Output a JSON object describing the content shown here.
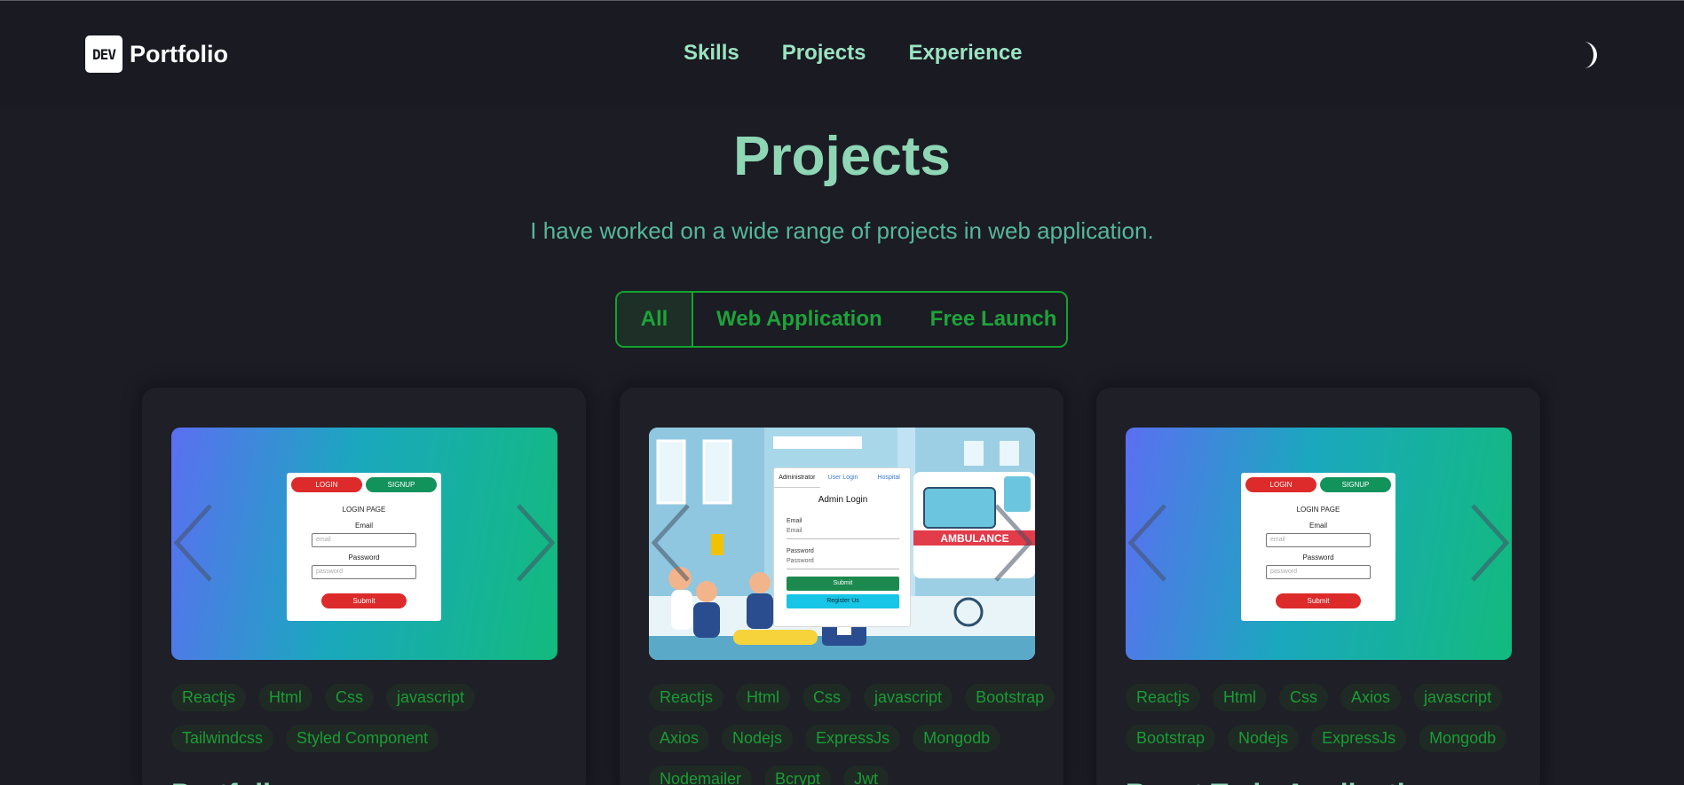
{
  "header": {
    "logo_badge": "DEV",
    "logo_text": "Portfolio",
    "nav": [
      "Skills",
      "Projects",
      "Experience"
    ],
    "theme_icon": "moon-icon"
  },
  "hero": {
    "title": "Projects",
    "subtitle": "I have worked on a wide range of projects in web application."
  },
  "filters": {
    "items": [
      "All",
      "Web Application",
      "Free Launch"
    ],
    "active": "All"
  },
  "projects": [
    {
      "title": "Portfolio",
      "tags": [
        "Reactjs",
        "Html",
        "Css",
        "javascript",
        "Tailwindcss",
        "Styled Component"
      ],
      "preview": {
        "login_tab": "LOGIN",
        "signup_tab": "SIGNUP",
        "heading": "LOGIN PAGE",
        "email_label": "Email",
        "email_placeholder": "email",
        "password_label": "Password",
        "password_placeholder": "password",
        "submit": "Submit"
      }
    },
    {
      "title": "",
      "tags": [
        "Reactjs",
        "Html",
        "Css",
        "javascript",
        "Bootstrap",
        "Axios",
        "Nodejs",
        "ExpressJs",
        "Mongodb",
        "Nodemailer",
        "Bcrypt",
        "Jwt"
      ],
      "preview": {
        "tabs": [
          "Administrator",
          "User Login",
          "Hospital"
        ],
        "heading": "Admin Login",
        "email_label": "Email",
        "email_placeholder": "Email",
        "password_label": "Password",
        "password_placeholder": "Password",
        "submit": "Submit",
        "register": "Register Us",
        "vehicle_text": "AMBULANCE"
      }
    },
    {
      "title": "React Todo Application",
      "tags": [
        "Reactjs",
        "Html",
        "Css",
        "Axios",
        "javascript",
        "Bootstrap",
        "Nodejs",
        "ExpressJs",
        "Mongodb"
      ],
      "preview": {
        "login_tab": "LOGIN",
        "signup_tab": "SIGNUP",
        "heading": "LOGIN PAGE",
        "email_label": "Email",
        "email_placeholder": "email",
        "password_label": "Password",
        "password_placeholder": "password",
        "submit": "Submit"
      }
    }
  ],
  "colors": {
    "background": "#1b1c24",
    "accent": "#8fd6b4",
    "filter_green": "#13a32e"
  }
}
